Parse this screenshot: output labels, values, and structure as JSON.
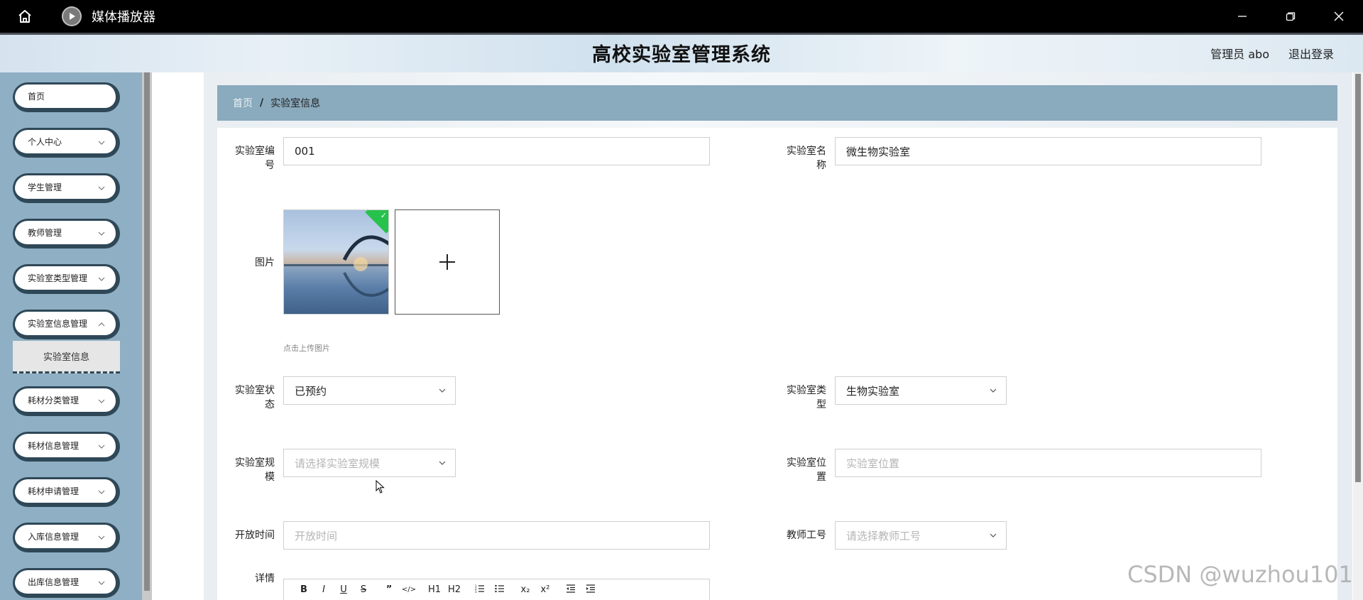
{
  "window": {
    "app_name": "媒体播放器",
    "buttons": [
      "minimize",
      "restore",
      "close"
    ]
  },
  "header": {
    "title": "高校实验室管理系统",
    "user": "管理员 abo",
    "logout": "退出登录"
  },
  "sidebar": {
    "items": [
      {
        "label": "首页"
      },
      {
        "label": "个人中心"
      },
      {
        "label": "学生管理"
      },
      {
        "label": "教师管理"
      },
      {
        "label": "实验室类型管理"
      },
      {
        "label": "实验室信息管理"
      },
      {
        "label": "耗材分类管理"
      },
      {
        "label": "耗材信息管理"
      },
      {
        "label": "耗材申请管理"
      },
      {
        "label": "入库信息管理"
      },
      {
        "label": "出库信息管理"
      }
    ],
    "submenu_active": "实验室信息"
  },
  "breadcrumb": {
    "home": "首页",
    "separator": "/",
    "current": "实验室信息"
  },
  "form": {
    "lab_no_label": "实验室编号",
    "lab_no_value": "001",
    "lab_name_label": "实验室名称",
    "lab_name_value": "微生物实验室",
    "image_label": "图片",
    "upload_hint": "点击上传图片",
    "status_label": "实验室状态",
    "status_value": "已预约",
    "type_label": "实验室类型",
    "type_value": "生物实验室",
    "scale_label": "实验室规模",
    "scale_placeholder": "请选择实验室规模",
    "location_label": "实验室位置",
    "location_placeholder": "实验室位置",
    "open_time_label": "开放时间",
    "open_time_placeholder": "开放时间",
    "teacher_no_label": "教师工号",
    "teacher_no_placeholder": "请选择教师工号",
    "detail_label": "详情",
    "editor_tools": [
      "B",
      "I",
      "U",
      "S",
      "”",
      "</>",
      "H1",
      "H2",
      "ol",
      "ul",
      "x₂",
      "x²",
      "outdent",
      "indent"
    ]
  },
  "watermark": "CSDN @wuzhou101",
  "colors": {
    "sidebar_bg": "#8fafc4",
    "menu_border": "#2f4858",
    "breadcrumb_bg": "#8aaabd",
    "success_badge": "#27c24c"
  }
}
